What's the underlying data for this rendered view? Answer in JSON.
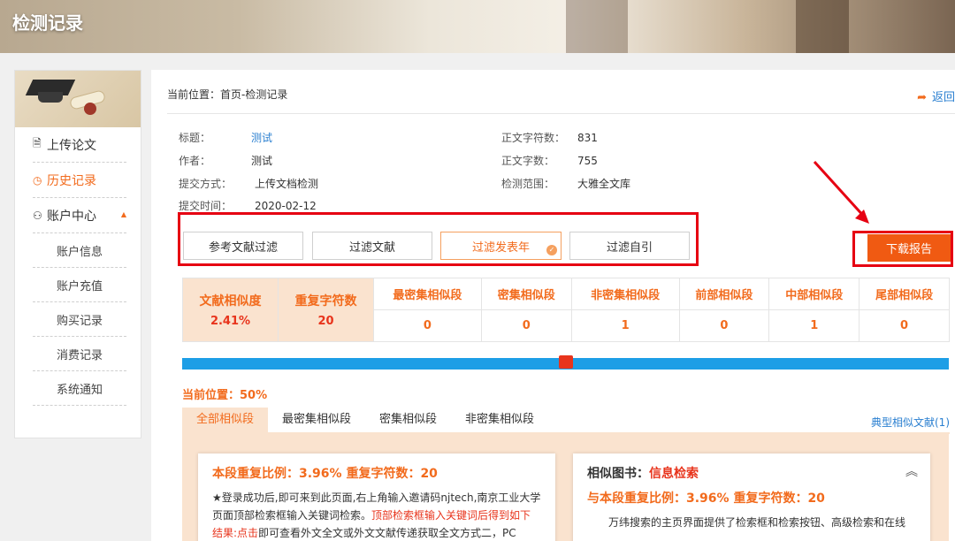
{
  "banner": {
    "title": "检测记录"
  },
  "sidebar": {
    "items": [
      {
        "label": "上传论文",
        "icon": "document-icon"
      },
      {
        "label": "历史记录",
        "icon": "clock-icon"
      },
      {
        "label": "账户中心",
        "icon": "user-icon"
      }
    ],
    "sub_items": [
      "账户信息",
      "账户充值",
      "购买记录",
      "消费记录",
      "系统通知"
    ]
  },
  "breadcrumb": "当前位置：首页-检测记录",
  "back_label": "返回",
  "info": {
    "title_label": "标题：",
    "title_value": "测试",
    "author_label": "作者：",
    "author_value": "测试",
    "submit_label": "提交方式：",
    "submit_value": "上传文档检测",
    "time_label": "提交时间：",
    "time_value": "2020-02-12",
    "chars_label": "正文字符数：",
    "chars_value": "831",
    "words_label": "正文字数：",
    "words_value": "755",
    "scope_label": "检测范围：",
    "scope_value": "大雅全文库"
  },
  "filters": [
    "参考文献过滤",
    "过滤文献",
    "过滤发表年",
    "过滤自引"
  ],
  "download_label": "下载报告",
  "stats": {
    "similarity_label": "文献相似度",
    "similarity_value": "2.41%",
    "repeat_label": "重复字符数",
    "repeat_value": "20",
    "columns": [
      {
        "label": "最密集相似段",
        "value": "0"
      },
      {
        "label": "密集相似段",
        "value": "0"
      },
      {
        "label": "非密集相似段",
        "value": "1"
      },
      {
        "label": "前部相似段",
        "value": "0"
      },
      {
        "label": "中部相似段",
        "value": "1"
      },
      {
        "label": "尾部相似段",
        "value": "0"
      }
    ]
  },
  "position_label": "当前位置：50%",
  "position_marker": 0.5,
  "tabs": [
    "全部相似段",
    "最密集相似段",
    "密集相似段",
    "非密集相似段"
  ],
  "typical_link": "典型相似文献(1)",
  "left_card": {
    "heading": "本段重复比例：3.96% 重复字符数：20",
    "text_before": "★登录成功后,即可来到此页面,右上角输入邀请码njtech,南京工业大学页面顶部检索框输入关键词检索。",
    "text_red": "顶部检索框输入关键词后得到如下结果:点击",
    "text_after": "即可查看外文全文或外文文献传递获取全文方式二，PC"
  },
  "right_card": {
    "prefix": "相似图书：",
    "book": "信息检索",
    "heading": "与本段重复比例：3.96% 重复字符数：20",
    "text": "万纬搜索的主页界面提供了检索框和检索按钮、高级检索和在线"
  },
  "colors": {
    "accent": "#f26b1d",
    "highlight": "#e60012",
    "bar": "#1d9ee6",
    "link": "#2a7fd0"
  }
}
